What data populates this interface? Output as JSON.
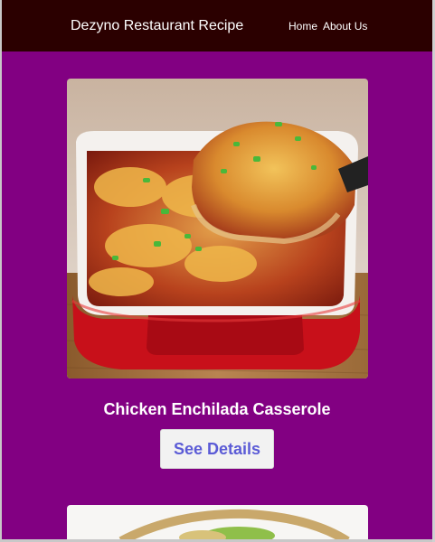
{
  "header": {
    "brand": "Dezyno Restaurant Recipe",
    "nav": [
      "Home",
      "About Us"
    ]
  },
  "cards": [
    {
      "title": "Chicken Enchilada Casserole",
      "button_label": "See Details"
    }
  ],
  "colors": {
    "navbar": "#2b0000",
    "page_background": "#820082",
    "button_text": "#5b5bd6"
  }
}
